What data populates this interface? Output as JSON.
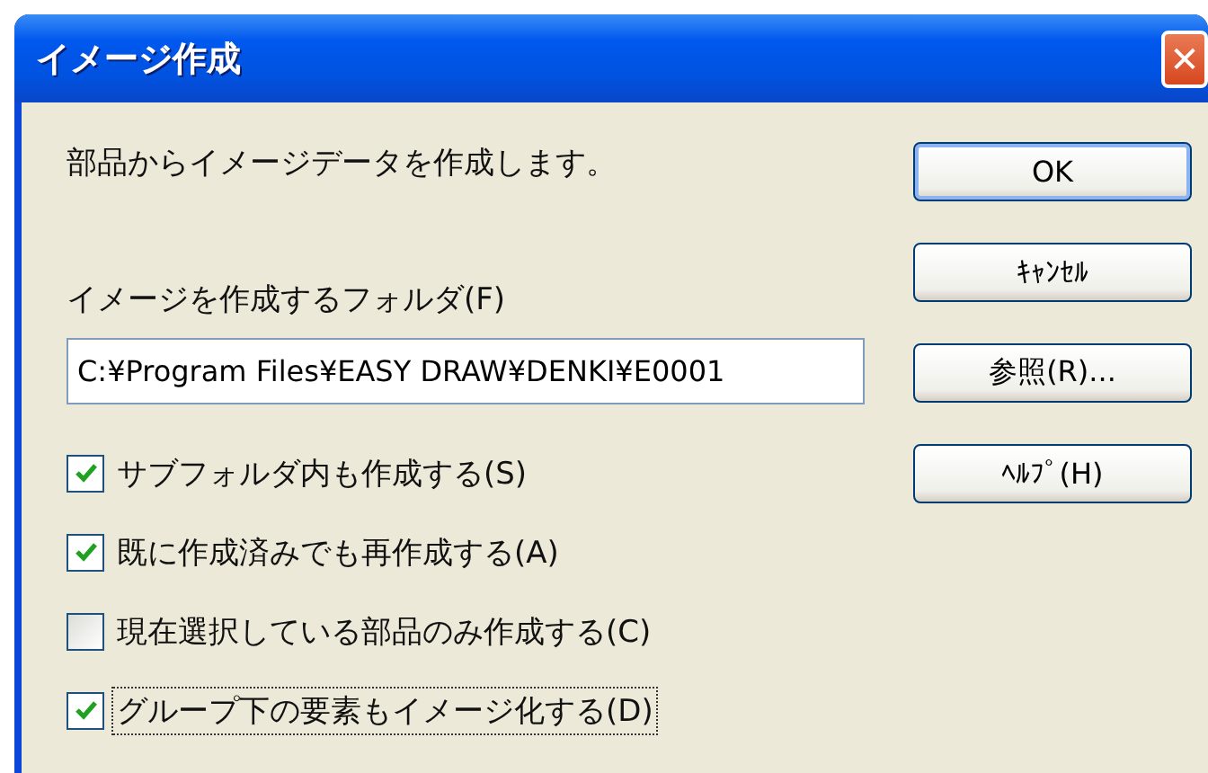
{
  "window": {
    "title": "イメージ作成",
    "close_label": "✕"
  },
  "description": "部品からイメージデータを作成します。",
  "folder": {
    "label": "イメージを作成するフォルダ(F)",
    "value": "C:¥Program Files¥EASY DRAW¥DENKI¥E0001"
  },
  "options": [
    {
      "label": "サブフォルダ内も作成する(S)",
      "checked": true,
      "focused": false
    },
    {
      "label": "既に作成済みでも再作成する(A)",
      "checked": true,
      "focused": false
    },
    {
      "label": "現在選択している部品のみ作成する(C)",
      "checked": false,
      "focused": false
    },
    {
      "label": "グループ下の要素もイメージ化する(D)",
      "checked": true,
      "focused": true
    }
  ],
  "buttons": [
    {
      "label": "OK",
      "default": true
    },
    {
      "label": "ｷｬﾝｾﾙ",
      "default": false
    },
    {
      "label": "参照(R)...",
      "default": false
    },
    {
      "label": "ﾍﾙﾌﾟ(H)",
      "default": false
    }
  ]
}
